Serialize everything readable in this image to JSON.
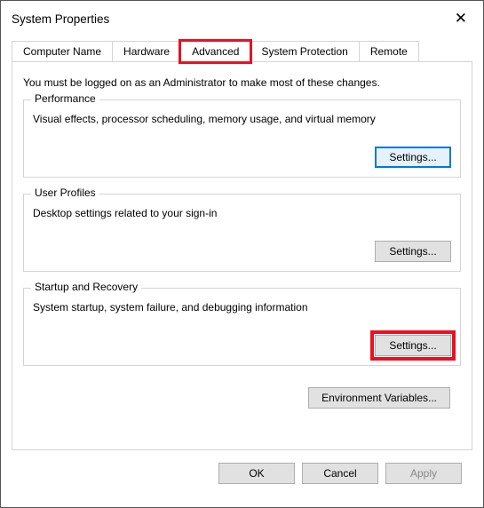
{
  "window": {
    "title": "System Properties"
  },
  "tabs": {
    "computer_name": "Computer Name",
    "hardware": "Hardware",
    "advanced": "Advanced",
    "system_protection": "System Protection",
    "remote": "Remote"
  },
  "advanced_panel": {
    "intro": "You must be logged on as an Administrator to make most of these changes.",
    "performance": {
      "legend": "Performance",
      "desc": "Visual effects, processor scheduling, memory usage, and virtual memory",
      "settings_label": "Settings..."
    },
    "user_profiles": {
      "legend": "User Profiles",
      "desc": "Desktop settings related to your sign-in",
      "settings_label": "Settings..."
    },
    "startup_recovery": {
      "legend": "Startup and Recovery",
      "desc": "System startup, system failure, and debugging information",
      "settings_label": "Settings..."
    },
    "env_vars_label": "Environment Variables..."
  },
  "footer": {
    "ok": "OK",
    "cancel": "Cancel",
    "apply": "Apply"
  }
}
